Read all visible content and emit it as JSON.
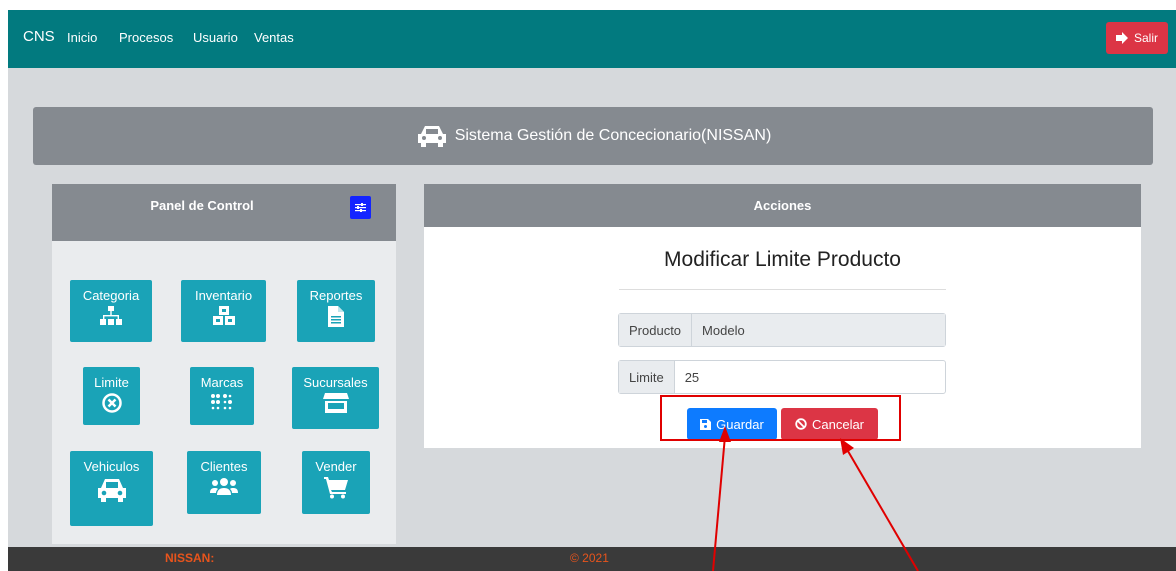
{
  "navbar": {
    "brand": "CNS",
    "links": [
      "Inicio",
      "Procesos",
      "Usuario",
      "Ventas"
    ],
    "logout_label": "Salir"
  },
  "banner": {
    "title": "Sistema Gestión de Concecionario(NISSAN)"
  },
  "panel": {
    "title": "Panel de Control",
    "tiles": [
      {
        "label": "Categoria",
        "icon": "sitemap-icon"
      },
      {
        "label": "Inventario",
        "icon": "cubes-icon"
      },
      {
        "label": "Reportes",
        "icon": "file-icon"
      },
      {
        "label": "Limite",
        "icon": "times-circle-icon"
      },
      {
        "label": "Marcas",
        "icon": "braille-icon"
      },
      {
        "label": "Sucursales",
        "icon": "store-icon"
      },
      {
        "label": "Vehiculos",
        "icon": "car-icon"
      },
      {
        "label": "Clientes",
        "icon": "users-icon"
      },
      {
        "label": "Vender",
        "icon": "cart-icon"
      }
    ]
  },
  "acciones": {
    "header": "Acciones",
    "form_title": "Modificar Limite Producto",
    "producto": {
      "label": "Producto",
      "value": "Modelo"
    },
    "limite": {
      "label": "Limite",
      "value": "25"
    },
    "save_label": "Guardar",
    "cancel_label": "Cancelar"
  },
  "footer": {
    "left": "NISSAN:",
    "center": "© 2021"
  },
  "colors": {
    "navbar": "#027a7f",
    "tile": "#1aa3b7",
    "primary": "#0d7bff",
    "danger": "#dc3545",
    "annotation": "#e00000"
  }
}
